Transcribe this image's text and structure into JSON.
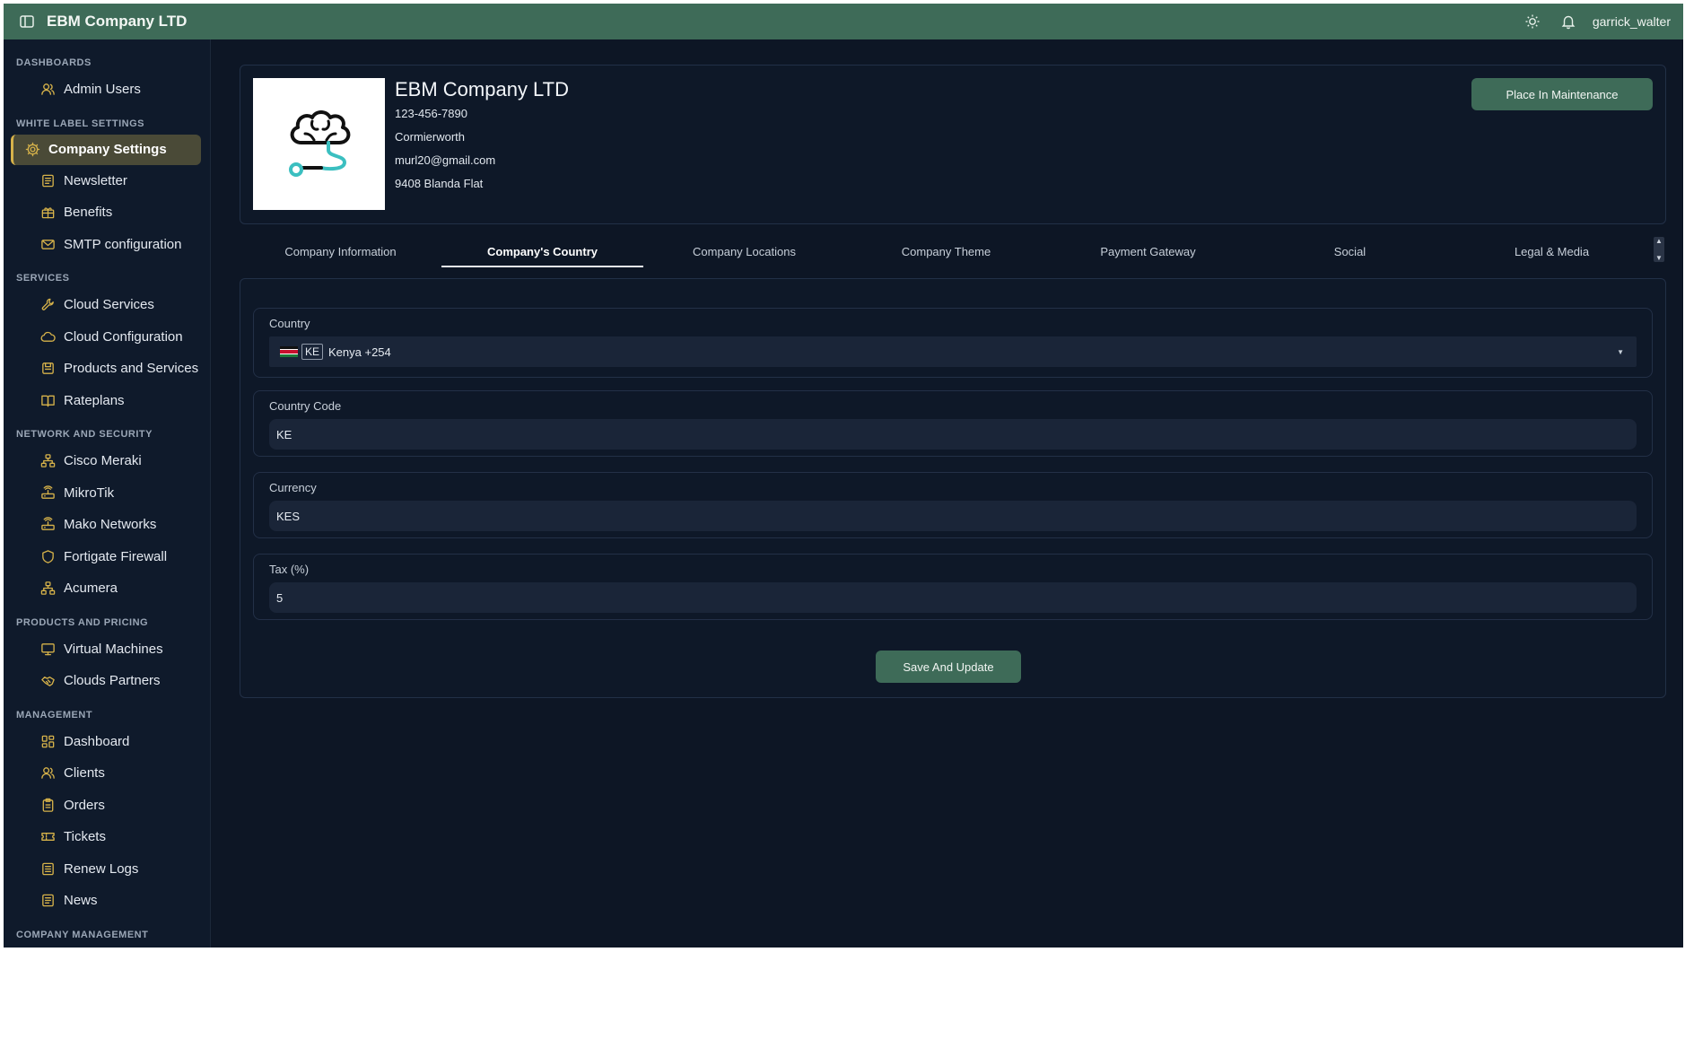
{
  "topbar": {
    "title": "EBM Company LTD",
    "username": "garrick_walter",
    "accent_color": "#3e6b58"
  },
  "sidebar": {
    "sections": [
      {
        "title": "DASHBOARDS",
        "items": [
          {
            "label": "Admin Users",
            "icon": "users-icon"
          }
        ]
      },
      {
        "title": "WHITE LABEL SETTINGS",
        "items": [
          {
            "label": "Company Settings",
            "icon": "gear-icon",
            "active": true
          },
          {
            "label": "Newsletter",
            "icon": "newspaper-icon"
          },
          {
            "label": "Benefits",
            "icon": "gift-icon"
          },
          {
            "label": "SMTP configuration",
            "icon": "mail-icon"
          }
        ]
      },
      {
        "title": "SERVICES",
        "items": [
          {
            "label": "Cloud Services",
            "icon": "wrench-icon"
          },
          {
            "label": "Cloud Configuration",
            "icon": "cloud-icon"
          },
          {
            "label": "Products and Services",
            "icon": "package-icon"
          },
          {
            "label": "Rateplans",
            "icon": "book-icon"
          }
        ]
      },
      {
        "title": "NETWORK AND SECURITY",
        "items": [
          {
            "label": "Cisco Meraki",
            "icon": "network-icon"
          },
          {
            "label": "MikroTik",
            "icon": "router-icon"
          },
          {
            "label": "Mako Networks",
            "icon": "router-icon"
          },
          {
            "label": "Fortigate Firewall",
            "icon": "shield-icon"
          },
          {
            "label": "Acumera",
            "icon": "network-icon"
          }
        ]
      },
      {
        "title": "PRODUCTS AND PRICING",
        "items": [
          {
            "label": "Virtual Machines",
            "icon": "monitor-icon"
          },
          {
            "label": "Clouds Partners",
            "icon": "handshake-icon"
          }
        ]
      },
      {
        "title": "MANAGEMENT",
        "items": [
          {
            "label": "Dashboard",
            "icon": "grid-icon"
          },
          {
            "label": "Clients",
            "icon": "users-icon"
          },
          {
            "label": "Orders",
            "icon": "clipboard-icon"
          },
          {
            "label": "Tickets",
            "icon": "ticket-icon"
          },
          {
            "label": "Renew Logs",
            "icon": "list-icon"
          },
          {
            "label": "News",
            "icon": "newspaper-icon"
          }
        ]
      },
      {
        "title": "COMPANY MANAGEMENT",
        "items": []
      }
    ]
  },
  "profile": {
    "name": "EBM Company LTD",
    "phone": "123-456-7890",
    "city": "Cormierworth",
    "email": "murl20@gmail.com",
    "address": "9408 Blanda Flat",
    "maintenance_label": "Place In Maintenance"
  },
  "tabs": [
    {
      "label": "Company Information"
    },
    {
      "label": "Company's Country",
      "active": true
    },
    {
      "label": "Company Locations"
    },
    {
      "label": "Company Theme"
    },
    {
      "label": "Payment Gateway"
    },
    {
      "label": "Social"
    },
    {
      "label": "Legal & Media"
    }
  ],
  "form": {
    "country": {
      "label": "Country",
      "iso": "KE",
      "value": "Kenya +254"
    },
    "country_code": {
      "label": "Country Code",
      "value": "KE"
    },
    "currency": {
      "label": "Currency",
      "value": "KES"
    },
    "tax": {
      "label": "Tax (%)",
      "value": "5"
    },
    "save_label": "Save And Update"
  }
}
